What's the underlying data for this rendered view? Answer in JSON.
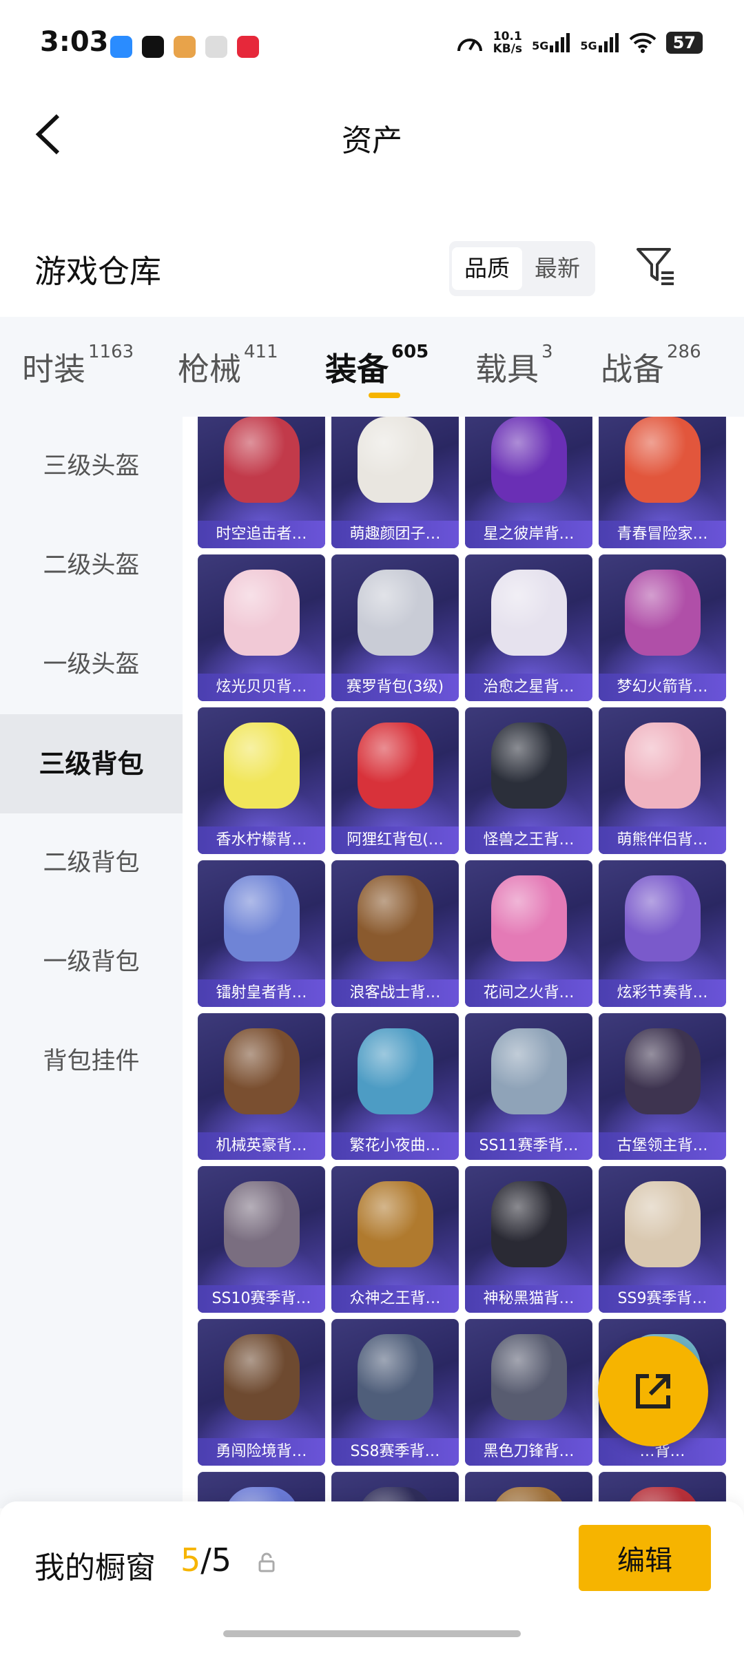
{
  "status": {
    "time": "3:03",
    "speed_value": "10.1",
    "speed_unit": "KB/s",
    "sim1": "5G",
    "sim2": "5G",
    "battery": "57",
    "apps": [
      "#2a8cff",
      "#111111",
      "#e8a34a",
      "#dddddd",
      "#e6283a"
    ]
  },
  "nav": {
    "title": "资产"
  },
  "header": {
    "title": "游戏仓库",
    "sort": [
      "品质",
      "最新"
    ]
  },
  "tabs": [
    {
      "label": "时装",
      "count": "1163"
    },
    {
      "label": "枪械",
      "count": "411"
    },
    {
      "label": "装备",
      "count": "605"
    },
    {
      "label": "载具",
      "count": "3"
    },
    {
      "label": "战备",
      "count": "286"
    }
  ],
  "sidebar": [
    {
      "label": "三级头盔"
    },
    {
      "label": "二级头盔"
    },
    {
      "label": "一级头盔"
    },
    {
      "label": "三级背包"
    },
    {
      "label": "二级背包"
    },
    {
      "label": "一级背包"
    },
    {
      "label": "背包挂件"
    }
  ],
  "items": [
    {
      "name": "时空追击者…",
      "color": "#c23a4a"
    },
    {
      "name": "萌趣颜团子…",
      "color": "#e9e6e0"
    },
    {
      "name": "星之彼岸背…",
      "color": "#6a2fb5"
    },
    {
      "name": "青春冒险家…",
      "color": "#e2563c"
    },
    {
      "name": "炫光贝贝背…",
      "color": "#f1c9d6"
    },
    {
      "name": "赛罗背包(3级)",
      "color": "#c9ccd6"
    },
    {
      "name": "治愈之星背…",
      "color": "#e6e2ee"
    },
    {
      "name": "梦幻火箭背…",
      "color": "#b04fa8"
    },
    {
      "name": "香水柠檬背…",
      "color": "#f1e65a"
    },
    {
      "name": "阿狸红背包(…",
      "color": "#d8323a"
    },
    {
      "name": "怪兽之王背…",
      "color": "#2b2f3a"
    },
    {
      "name": "萌熊伴侣背…",
      "color": "#f0b3c0"
    },
    {
      "name": "镭射皇者背…",
      "color": "#6f84d6"
    },
    {
      "name": "浪客战士背…",
      "color": "#8a5a2e"
    },
    {
      "name": "花间之火背…",
      "color": "#e47ab6"
    },
    {
      "name": "炫彩节奏背…",
      "color": "#7a5acb"
    },
    {
      "name": "机械英豪背…",
      "color": "#7a4f30"
    },
    {
      "name": "繁花小夜曲…",
      "color": "#4d9cc4"
    },
    {
      "name": "SS11赛季背…",
      "color": "#8fa3b8"
    },
    {
      "name": "古堡领主背…",
      "color": "#3e3450"
    },
    {
      "name": "SS10赛季背…",
      "color": "#7a6e80"
    },
    {
      "name": "众神之王背…",
      "color": "#b07a2e"
    },
    {
      "name": "神秘黑猫背…",
      "color": "#2a2a34"
    },
    {
      "name": "SS9赛季背…",
      "color": "#d9c8b0"
    },
    {
      "name": "勇闯险境背…",
      "color": "#6e4a30"
    },
    {
      "name": "SS8赛季背…",
      "color": "#4f5e7a"
    },
    {
      "name": "黑色刀锋背…",
      "color": "#585c70"
    },
    {
      "name": "…背…",
      "color": "#6fb2c4"
    },
    {
      "name": "",
      "color": "#6a7ad6"
    },
    {
      "name": "",
      "color": "#2f2d5a"
    },
    {
      "name": "",
      "color": "#a0713a"
    },
    {
      "name": "",
      "color": "#b8303a"
    }
  ],
  "bottom": {
    "title": "我的橱窗",
    "current": "5",
    "sep": "/",
    "total": "5",
    "edit": "编辑"
  }
}
